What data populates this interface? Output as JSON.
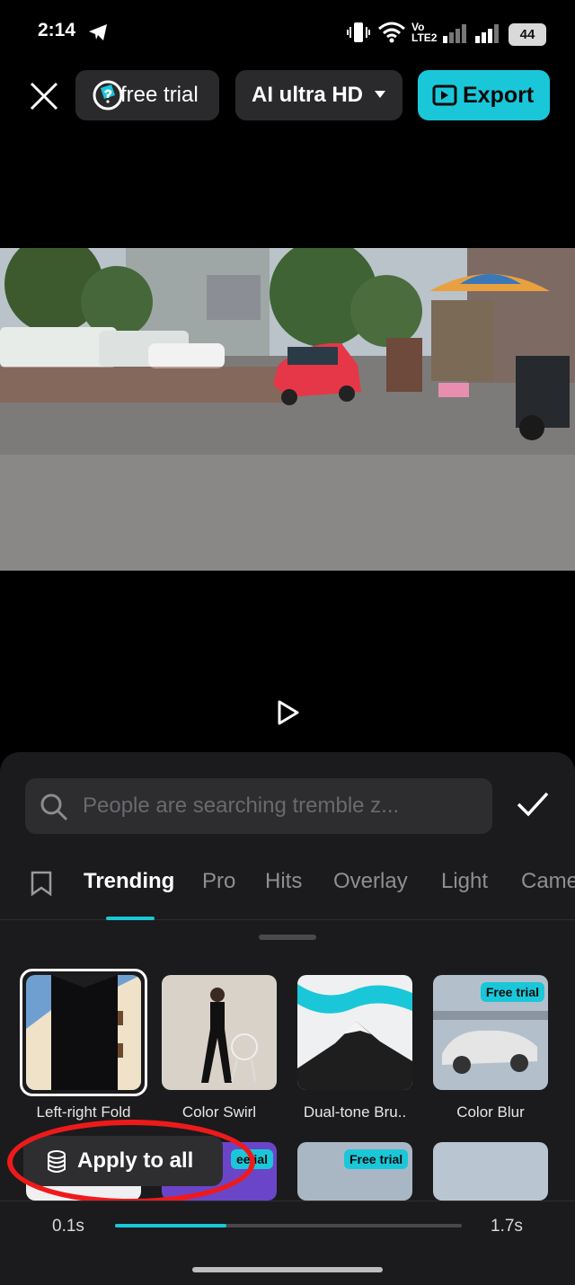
{
  "status_bar": {
    "time": "2:14",
    "lte_top": "Vo",
    "lte_bottom": "LTE2",
    "battery": "44"
  },
  "top_bar": {
    "free_trial_label": "free trial",
    "quality_label": "AI ultra HD",
    "export_label": "Export"
  },
  "search": {
    "placeholder": "People are searching tremble z..."
  },
  "tabs": [
    "Trending",
    "Pro",
    "Hits",
    "Overlay",
    "Light",
    "Came"
  ],
  "active_tab": "Trending",
  "effects_row1": [
    {
      "label": "Left-right Fold",
      "selected": true,
      "badge": ""
    },
    {
      "label": "Color Swirl",
      "selected": false,
      "badge": ""
    },
    {
      "label": "Dual-tone Bru..",
      "selected": false,
      "badge": ""
    },
    {
      "label": "Color Blur",
      "selected": false,
      "badge": "Free trial"
    }
  ],
  "effects_row2_badges": [
    "",
    "ee  ial",
    "Free trial",
    ""
  ],
  "apply_all_label": "Apply to all",
  "timeline": {
    "start": "0.1s",
    "end": "1.7s",
    "progress": 0.32
  },
  "colors": {
    "accent": "#1ac7d9",
    "highlight_ring": "#ee1a1a",
    "panel": "#1b1b1d"
  }
}
